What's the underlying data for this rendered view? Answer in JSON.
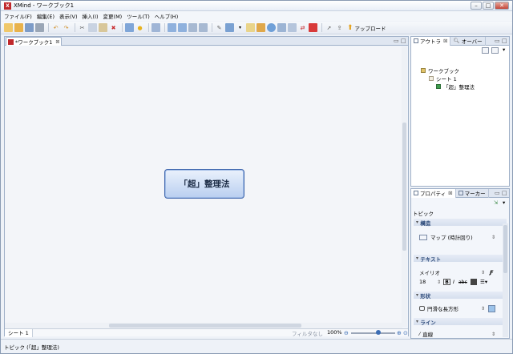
{
  "window": {
    "title": "XMind - ワークブック1"
  },
  "menubar": {
    "items": [
      "ファイル(F)",
      "編集(E)",
      "表示(V)",
      "挿入(I)",
      "変更(M)",
      "ツール(T)",
      "ヘルプ(H)"
    ]
  },
  "toolbar": {
    "upload_label": "アップロード"
  },
  "editor": {
    "tab_label": "*ワークブック1",
    "central_topic": "「超」整理法",
    "sheet_tab": "シート 1",
    "filter_label": "フィルタなし",
    "zoom": "100%"
  },
  "outline": {
    "tabs": [
      "アウトラ",
      "オーバー"
    ],
    "tree": [
      "ワークブック",
      "シート 1",
      "「超」整理法"
    ]
  },
  "properties": {
    "tabs": [
      "プロパティ",
      "マーカー"
    ],
    "header": "トピック",
    "sections": {
      "structure": {
        "title": "構造",
        "value": "マップ (時計回り)"
      },
      "text": {
        "title": "テキスト",
        "font": "メイリオ",
        "size": "18"
      },
      "shape": {
        "title": "形状",
        "value": "円滑な長方形",
        "color": "#9cc3ea"
      },
      "line": {
        "title": "ライン",
        "value": "直線"
      }
    }
  },
  "statusbar": {
    "text": "トピック (「超」整理法)"
  },
  "colors": {
    "accent": "#3f66ad",
    "brand": "#c0282b"
  }
}
